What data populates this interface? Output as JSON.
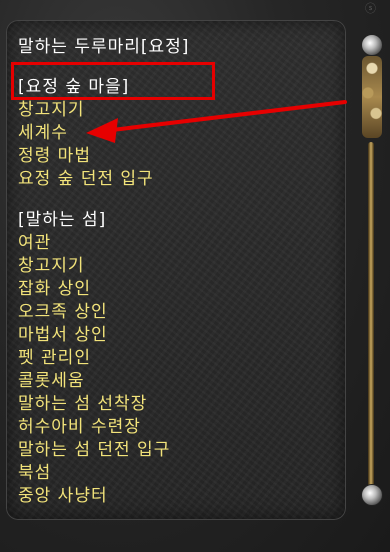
{
  "dialog": {
    "title": "말하는 두루마리[요정]"
  },
  "sections": [
    {
      "heading": "[요정 숲 마을]",
      "items": [
        "창고지기",
        "세계수",
        "정령 마법",
        "요정 숲 던전 입구"
      ]
    },
    {
      "heading": "[말하는 섬]",
      "items": [
        "여관",
        "창고지기",
        "잡화 상인",
        "오크족 상인",
        "마법서 상인",
        "펫 관리인",
        "콜롯세움",
        "말하는 섬 선착장",
        "허수아비 수련장",
        "말하는 섬 던전 입구",
        "북섬",
        "중앙 사냥터"
      ]
    }
  ],
  "colors": {
    "title_text": "#ffffff",
    "item_text": "#f2e37a",
    "highlight": "#e60000"
  },
  "icons": {
    "arrow": "red-pointer-arrow",
    "scroll_top": "scroll-knob-top",
    "scroll_bottom": "scroll-knob-bottom"
  }
}
